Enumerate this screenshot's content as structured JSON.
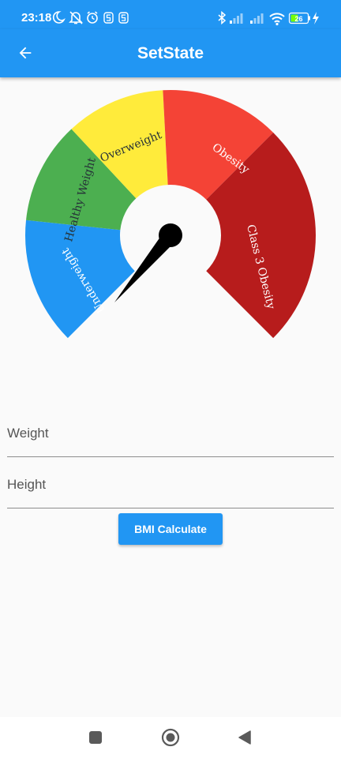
{
  "status_bar": {
    "time": "23:18",
    "battery": "26",
    "left_icons": [
      "moon-icon",
      "bell-off-icon",
      "alarm-icon",
      "s-icon",
      "s-icon"
    ],
    "right_icons": [
      "bluetooth-icon",
      "signal-icon",
      "signal-icon",
      "wifi-icon",
      "battery-icon",
      "charging-icon"
    ]
  },
  "app_bar": {
    "title": "SetState",
    "back_icon": "arrow-left-icon"
  },
  "gauge": {
    "segments": [
      {
        "label": "Underweight",
        "color": "#2196f3"
      },
      {
        "label": "Healthy Weight",
        "color": "#4caf50"
      },
      {
        "label": "Overweight",
        "color": "#ffeb3b"
      },
      {
        "label": "Obesity",
        "color": "#f44336"
      },
      {
        "label": "Class 3 Obesity",
        "color": "#b71c1c"
      }
    ],
    "needle_color": "#000000"
  },
  "form": {
    "weight_placeholder": "Weight",
    "weight_value": "",
    "height_placeholder": "Height",
    "height_value": "",
    "calculate_label": "BMI Calculate"
  },
  "nav_bar": {
    "icons": [
      "square-icon",
      "circle-icon",
      "triangle-back-icon"
    ]
  },
  "colors": {
    "primary": "#2196f3",
    "background": "#fafafa"
  }
}
